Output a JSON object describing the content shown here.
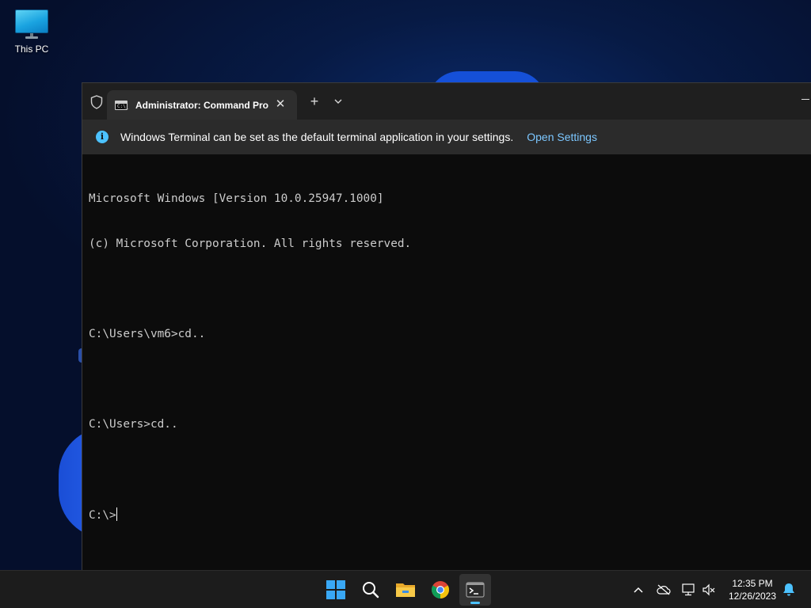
{
  "desktop": {
    "icons": [
      {
        "label": "This PC",
        "icon": "monitor-icon"
      }
    ]
  },
  "terminal": {
    "tab": {
      "title": "Administrator: Command Pro",
      "icon": "cmd-icon",
      "icon_glyph": "C:\\_"
    },
    "new_tab_symbol": "+",
    "close_symbol": "✕",
    "infobar": {
      "message": "Windows Terminal can be set as the default terminal application in your settings.",
      "link_label": "Open Settings",
      "icon_glyph": "i"
    },
    "console_lines": [
      "Microsoft Windows [Version 10.0.25947.1000]",
      "(c) Microsoft Corporation. All rights reserved.",
      "",
      "C:\\Users\\vm6>cd..",
      "",
      "C:\\Users>cd..",
      ""
    ],
    "prompt": "C:\\>"
  },
  "taskbar": {
    "apps": [
      "start-icon",
      "search-icon",
      "file-explorer-icon",
      "chrome-icon",
      "terminal-icon"
    ],
    "tray": [
      "chevron-up-icon",
      "onedrive-offline-icon",
      "network-icon",
      "volume-muted-icon",
      "notification-bell-icon"
    ],
    "clock": {
      "time": "12:35 PM",
      "date": "12/26/2023"
    }
  },
  "colors": {
    "accent": "#4cc2ff",
    "console_bg": "#0c0c0c",
    "console_text": "#cccccc",
    "link": "#7cc7ff"
  }
}
